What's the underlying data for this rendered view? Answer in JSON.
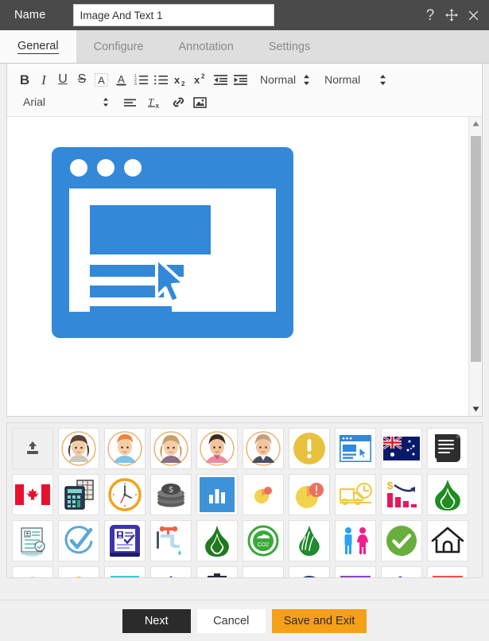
{
  "window": {
    "name_label": "Name",
    "name_value": "Image And Text 1",
    "help_icon": "question-mark-icon",
    "move_icon": "move-arrows-icon",
    "close_icon": "close-icon"
  },
  "tabs": [
    {
      "label": "General",
      "active": true
    },
    {
      "label": "Configure",
      "active": false
    },
    {
      "label": "Annotation",
      "active": false
    },
    {
      "label": "Settings",
      "active": false
    }
  ],
  "toolbar": {
    "row1": [
      {
        "name": "bold-icon",
        "glyph": "B"
      },
      {
        "name": "italic-icon",
        "glyph": "I"
      },
      {
        "name": "underline-icon",
        "glyph": "U"
      },
      {
        "name": "strikethrough-icon",
        "glyph": "S"
      },
      {
        "name": "highlight-color-icon",
        "glyph": "A"
      },
      {
        "name": "text-color-icon",
        "glyph": "A"
      },
      {
        "name": "ordered-list-icon",
        "glyph": ""
      },
      {
        "name": "unordered-list-icon",
        "glyph": ""
      },
      {
        "name": "subscript-icon",
        "glyph": "x"
      },
      {
        "name": "superscript-icon",
        "glyph": "x"
      },
      {
        "name": "outdent-icon",
        "glyph": ""
      },
      {
        "name": "indent-icon",
        "glyph": ""
      }
    ],
    "size_dropdown": {
      "name": "font-size-dropdown",
      "value": "Normal"
    },
    "style_dropdown": {
      "name": "paragraph-style-dropdown",
      "value": "Normal"
    },
    "font_dropdown": {
      "name": "font-family-dropdown",
      "value": "Arial"
    },
    "row2": [
      {
        "name": "align-icon"
      },
      {
        "name": "clear-formatting-icon"
      },
      {
        "name": "link-icon"
      },
      {
        "name": "insert-image-icon"
      }
    ]
  },
  "canvas": {
    "content_icon": "browser-window-with-cursor-icon",
    "scroll_up_icon": "scroll-up-arrow-icon",
    "scroll_down_icon": "scroll-down-arrow-icon",
    "scroll_thumb": "scrollbar-thumb"
  },
  "palette": {
    "rows": [
      [
        "upload-icon",
        "avatar-woman-brown-hair-icon",
        "avatar-man-orange-hair-icon",
        "avatar-woman-blonde-icon",
        "avatar-man-dark-hair-icon",
        "avatar-man-blonde-icon",
        "warning-exclamation-icon",
        "browser-window-icon",
        "australia-flag-icon",
        "scroll-document-icon"
      ],
      [
        "canada-flag-icon",
        "calculator-icon",
        "clock-icon",
        "coins-stack-icon",
        "bar-chart-blue-icon",
        "pie-chart-small-icon",
        "pie-chart-large-icon",
        "delivery-truck-clock-icon",
        "declining-bar-chart-icon",
        "green-flame-icon"
      ],
      [
        "checklist-document-icon",
        "check-circle-blue-icon",
        "id-card-purple-icon",
        "water-tap-icon",
        "green-flame-dark-icon",
        "co2-circle-icon",
        "green-leaf-flame-icon",
        "restroom-male-female-icon",
        "check-circle-green-icon",
        "house-outline-icon"
      ],
      [
        "partial-orange-icon",
        "partial-orange-dot-icon",
        "partial-cyan-bar-icon",
        "partial-blue-icon",
        "partial-dark-icon",
        "partial-blue-circle-icon",
        "partial-navy-arc-icon",
        "partial-purple-bar-icon",
        "partial-blue-shape-icon",
        "partial-red-bar-icon"
      ]
    ]
  },
  "footer": {
    "next_label": "Next",
    "cancel_label": "Cancel",
    "save_label": "Save and Exit"
  },
  "colors": {
    "titlebar": "#4a4a4a",
    "accent_blue": "#3388d8",
    "save_orange": "#f5a019",
    "next_dark": "#2b2b2b"
  }
}
